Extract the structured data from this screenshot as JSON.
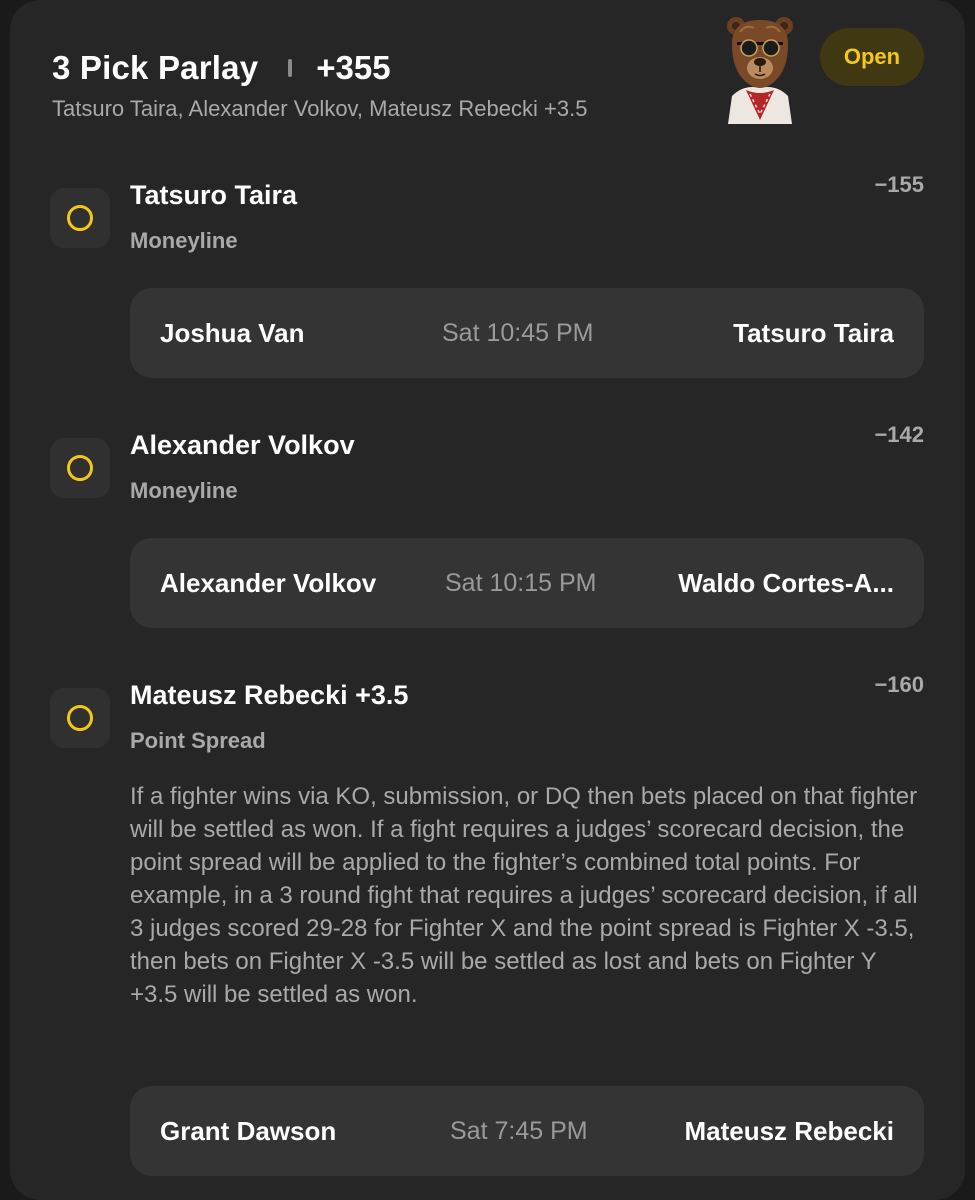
{
  "parlay": {
    "title": "3 Pick Parlay",
    "odds": "+355",
    "subtitle": "Tatsuro Taira, Alexander Volkov, Mateusz Rebecki +3.5",
    "status": "Open",
    "status_colors": {
      "text": "#f3c81c",
      "background": "#3f3812"
    },
    "avatar_icon": "bear-sunglasses-icon"
  },
  "legs": [
    {
      "pick": "Tatsuro Taira",
      "market": "Moneyline",
      "odds": "−155",
      "status_icon": "open-circle-icon",
      "matchup": {
        "left": "Joshua Van",
        "time": "Sat 10:45 PM",
        "right": "Tatsuro Taira"
      }
    },
    {
      "pick": "Alexander Volkov",
      "market": "Moneyline",
      "odds": "−142",
      "status_icon": "open-circle-icon",
      "matchup": {
        "left": "Alexander Volkov",
        "time": "Sat 10:15 PM",
        "right": "Waldo Cortes-A..."
      }
    },
    {
      "pick": "Mateusz Rebecki +3.5",
      "market": "Point Spread",
      "odds": "−160",
      "status_icon": "open-circle-icon",
      "description": "If a fighter wins via KO, submission, or DQ then bets placed on that fighter will be settled as won. If a fight requires a judges’ scorecard decision, the point spread will be applied to the fighter’s combined total points. For example, in a 3 round fight that requires a judges’ scorecard decision, if all 3 judges scored 29-28 for Fighter X and the point spread is Fighter X -3.5, then bets on Fighter X -3.5 will be settled as lost and bets on Fighter Y +3.5 will be settled as won.",
      "matchup": {
        "left": "Grant Dawson",
        "time": "Sat 7:45 PM",
        "right": "Mateusz Rebecki"
      }
    }
  ]
}
